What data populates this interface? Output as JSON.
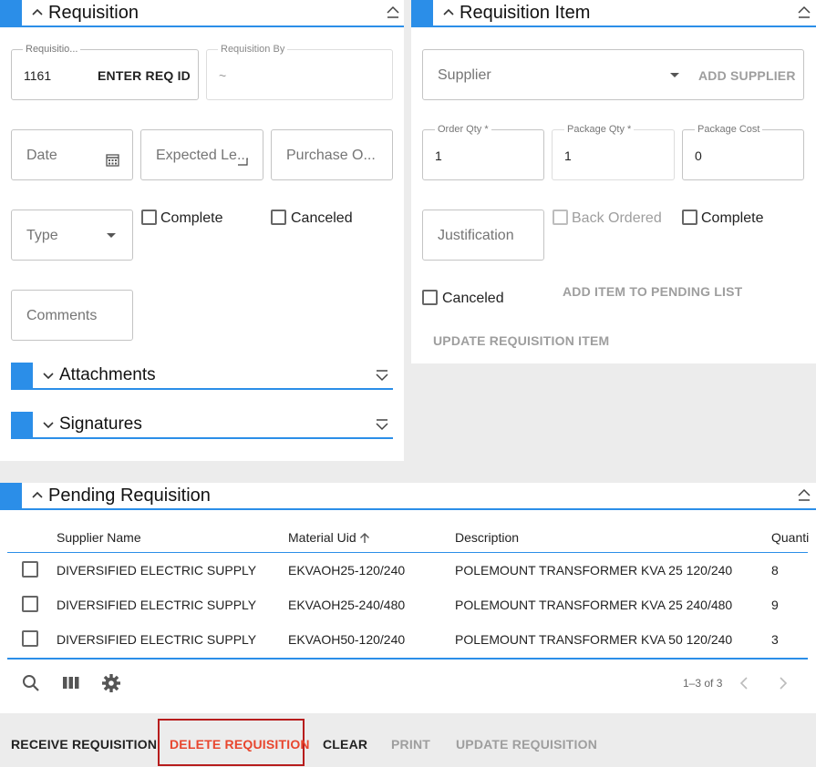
{
  "requisition": {
    "title": "Requisition",
    "requisition_label": "Requisitio...",
    "requisition_value": "1161",
    "enter_req_id": "ENTER REQ ID",
    "requisition_by_label": "Requisition By",
    "requisition_by_value": "~",
    "date_placeholder": "Date",
    "expected_placeholder": "Expected Le...",
    "purchase_placeholder": "Purchase O...",
    "type_placeholder": "Type",
    "complete_label": "Complete",
    "canceled_label": "Canceled",
    "comments_placeholder": "Comments",
    "attachments_title": "Attachments",
    "signatures_title": "Signatures"
  },
  "item": {
    "title": "Requisition Item",
    "supplier_placeholder": "Supplier",
    "add_supplier": "ADD SUPPLIER",
    "order_qty_label": "Order Qty *",
    "order_qty_value": "1",
    "package_qty_label": "Package Qty *",
    "package_qty_value": "1",
    "package_cost_label": "Package Cost",
    "package_cost_value": "0",
    "justification_placeholder": "Justification",
    "back_ordered_label": "Back Ordered",
    "complete_label": "Complete",
    "canceled_label": "Canceled",
    "add_item": "ADD ITEM TO PENDING LIST",
    "update_item": "UPDATE REQUISITION ITEM"
  },
  "pending": {
    "title": "Pending Requisition",
    "columns": [
      "Supplier Name",
      "Material Uid",
      "Description",
      "Quanti"
    ],
    "rows": [
      [
        "DIVERSIFIED ELECTRIC SUPPLY",
        "EKVAOH25-120/240",
        "POLEMOUNT TRANSFORMER KVA 25 120/240",
        "8"
      ],
      [
        "DIVERSIFIED ELECTRIC SUPPLY",
        "EKVAOH25-240/480",
        "POLEMOUNT TRANSFORMER KVA 25 240/480",
        "9"
      ],
      [
        "DIVERSIFIED ELECTRIC SUPPLY",
        "EKVAOH50-120/240",
        "POLEMOUNT TRANSFORMER KVA 50 120/240",
        "3"
      ]
    ],
    "pagination": "1–3 of 3"
  },
  "actions": {
    "receive": "RECEIVE REQUISITION",
    "delete": "DELETE REQUISITION",
    "clear": "CLEAR",
    "print": "PRINT",
    "update": "UPDATE REQUISITION"
  },
  "colors": {
    "accent": "#2b8ee8",
    "danger": "#e8462e",
    "highlight_border": "#b71c1c"
  }
}
